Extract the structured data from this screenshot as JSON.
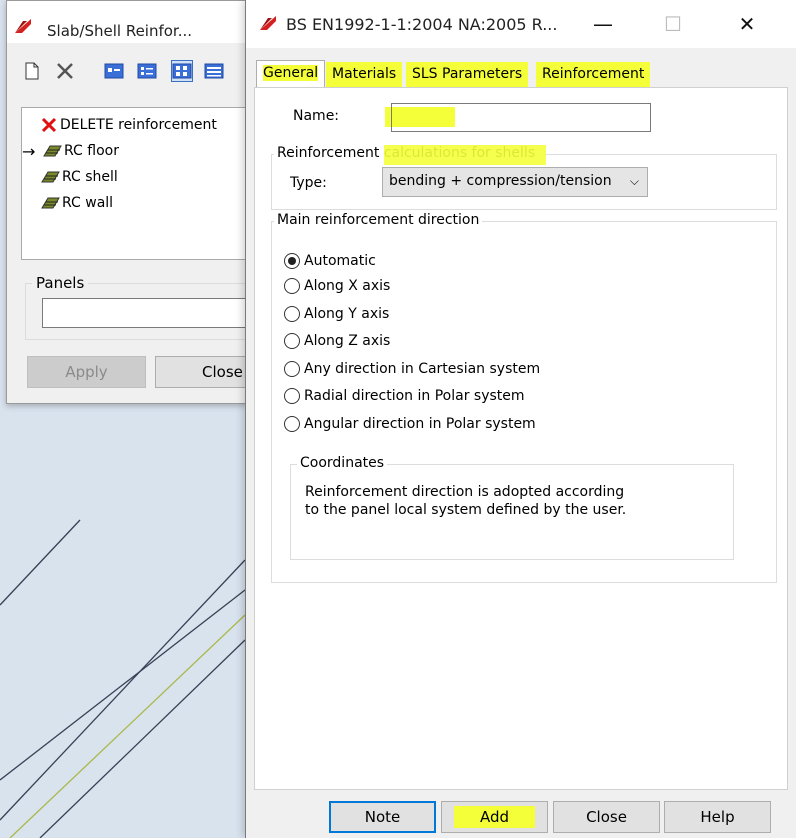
{
  "colors": {
    "highlight": "#f4ff3a",
    "accent_blue": "#0078d7",
    "green_line": "#18c23a"
  },
  "left_window": {
    "title": "Slab/Shell Reinfor...",
    "toolbar_icons": [
      "new-icon",
      "delete-icon",
      "view-small-icon",
      "view-detail-icon",
      "view-large-icon",
      "view-list-icon"
    ],
    "items": [
      {
        "label": "DELETE reinforcement",
        "icon": "red-x-icon",
        "current": false
      },
      {
        "label": "RC floor",
        "icon": "reinforcement-icon",
        "current": true
      },
      {
        "label": "RC shell",
        "icon": "reinforcement-icon",
        "current": false
      },
      {
        "label": "RC wall",
        "icon": "reinforcement-icon",
        "current": false
      }
    ],
    "panels_label": "Panels",
    "panels_value": "",
    "apply_label": "Apply",
    "close_label": "Close"
  },
  "main_window": {
    "title": "BS EN1992-1-1:2004 NA:2005 R...",
    "minimize": "—",
    "maximize": "☐",
    "close": "✕",
    "tabs": [
      {
        "label": "General",
        "active": true
      },
      {
        "label": "Materials",
        "active": false
      },
      {
        "label": "SLS Parameters",
        "active": false
      },
      {
        "label": "Reinforcement",
        "active": false
      }
    ],
    "name_label": "Name:",
    "name_value": "",
    "calc_group_title": "Reinforcement calculations for shells",
    "type_label": "Type:",
    "type_value": "bending + compression/tension",
    "direction_group_title": "Main reinforcement direction",
    "directions": [
      {
        "label": "Automatic",
        "checked": true
      },
      {
        "label": "Along X axis",
        "checked": false
      },
      {
        "label": "Along Y axis",
        "checked": false
      },
      {
        "label": "Along Z axis",
        "checked": false
      },
      {
        "label": "Any direction in Cartesian system",
        "checked": false
      },
      {
        "label": "Radial direction in Polar system",
        "checked": false
      },
      {
        "label": "Angular direction in Polar system",
        "checked": false
      }
    ],
    "coords_group_title": "Coordinates",
    "coords_note_line1": "Reinforcement direction is adopted according",
    "coords_note_line2": "to the panel local system defined by the user.",
    "buttons": {
      "note": "Note",
      "add": "Add",
      "close": "Close",
      "help": "Help"
    }
  }
}
